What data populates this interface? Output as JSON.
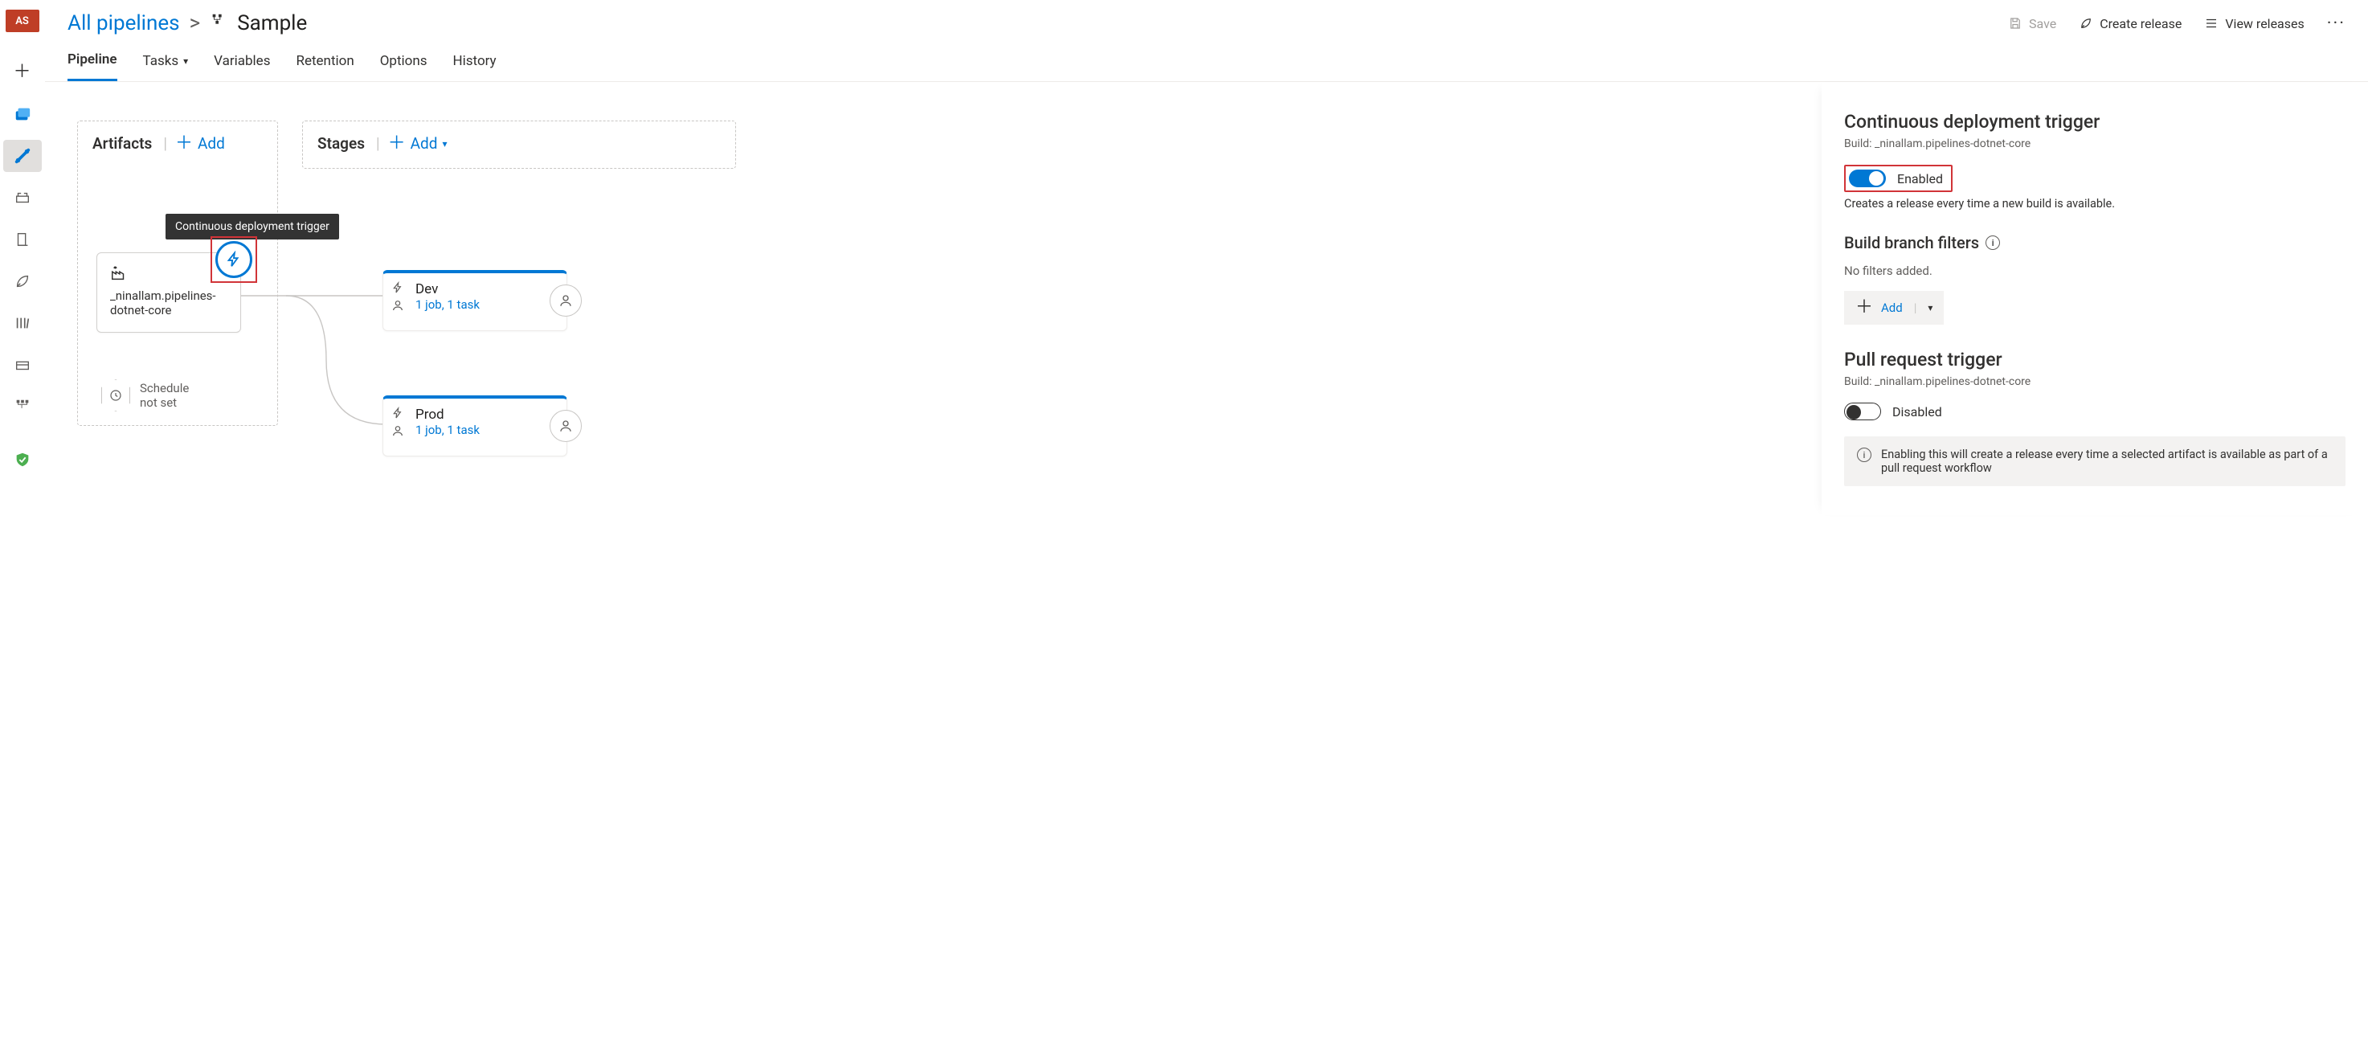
{
  "rail": {
    "avatar": "AS"
  },
  "breadcrumb": {
    "root": "All pipelines",
    "separator": ">",
    "current": "Sample"
  },
  "topActions": {
    "save": "Save",
    "createRelease": "Create release",
    "viewReleases": "View releases"
  },
  "tabs": [
    "Pipeline",
    "Tasks",
    "Variables",
    "Retention",
    "Options",
    "History"
  ],
  "canvas": {
    "artifactsHeader": "Artifacts",
    "stagesHeader": "Stages",
    "addLabel": "Add",
    "artifactName": "_ninallam.pipelines-dotnet-core",
    "triggerTooltip": "Continuous deployment trigger",
    "schedule": {
      "line1": "Schedule",
      "line2": "not set"
    },
    "stages": [
      {
        "name": "Dev",
        "meta": "1 job, 1 task"
      },
      {
        "name": "Prod",
        "meta": "1 job, 1 task"
      }
    ]
  },
  "panel": {
    "cdHeader": "Continuous deployment trigger",
    "cdBuild": "Build: _ninallam.pipelines-dotnet-core",
    "cdEnabled": "Enabled",
    "cdDesc": "Creates a release every time a new build is available.",
    "filtersHeader": "Build branch filters",
    "filtersEmpty": "No filters added.",
    "addLabel": "Add",
    "prHeader": "Pull request trigger",
    "prBuild": "Build: _ninallam.pipelines-dotnet-core",
    "prDisabled": "Disabled",
    "prInfo": "Enabling this will create a release every time a selected artifact is available as part of a pull request workflow"
  }
}
